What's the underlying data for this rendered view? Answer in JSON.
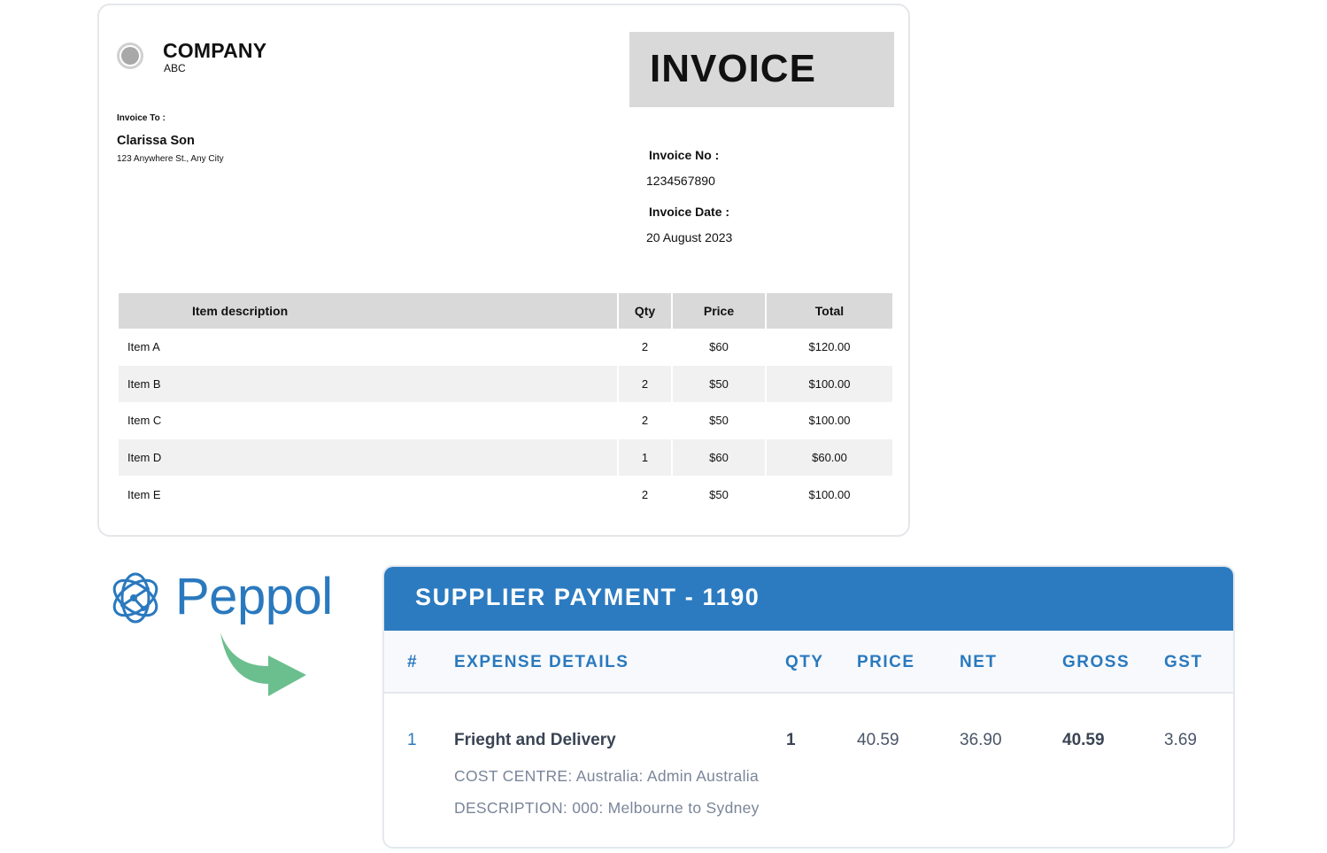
{
  "invoice": {
    "company": {
      "name": "COMPANY",
      "sub": "ABC"
    },
    "title": "INVOICE",
    "bill_to": {
      "label": "Invoice To :",
      "name": "Clarissa Son",
      "address": "123 Anywhere St., Any City"
    },
    "meta": {
      "number_label": "Invoice No :",
      "number": "1234567890",
      "date_label": "Invoice Date :",
      "date": "20 August 2023"
    },
    "table": {
      "headers": [
        "Item description",
        "Qty",
        "Price",
        "Total"
      ],
      "rows": [
        {
          "item": "Item A",
          "qty": "2",
          "price": "$60",
          "total": "$120.00"
        },
        {
          "item": "Item B",
          "qty": "2",
          "price": "$50",
          "total": "$100.00"
        },
        {
          "item": "Item C",
          "qty": "2",
          "price": "$50",
          "total": "$100.00"
        },
        {
          "item": "Item D",
          "qty": "1",
          "price": "$60",
          "total": "$60.00"
        },
        {
          "item": "Item E",
          "qty": "2",
          "price": "$50",
          "total": "$100.00"
        }
      ]
    }
  },
  "peppol": {
    "brand": "Peppol",
    "brand_color": "#2a79be",
    "arrow_color": "#6bbf8e",
    "logo_icon": "peppol-network-globe",
    "arrow_icon": "curved-arrow-right"
  },
  "payment": {
    "title": "SUPPLIER PAYMENT - 1190",
    "header_color": "#2c7bc0",
    "columns": {
      "num": "#",
      "details": "EXPENSE DETAILS",
      "qty": "QTY",
      "price": "PRICE",
      "net": "NET",
      "gross": "GROSS",
      "gst": "GST"
    },
    "row": {
      "num": "1",
      "details": "Frieght and Delivery",
      "qty": "1",
      "price": "40.59",
      "net": "36.90",
      "gross": "40.59",
      "gst": "3.69",
      "cost_centre": "COST CENTRE: Australia: Admin Australia",
      "description": "DESCRIPTION: 000: Melbourne to Sydney"
    }
  }
}
